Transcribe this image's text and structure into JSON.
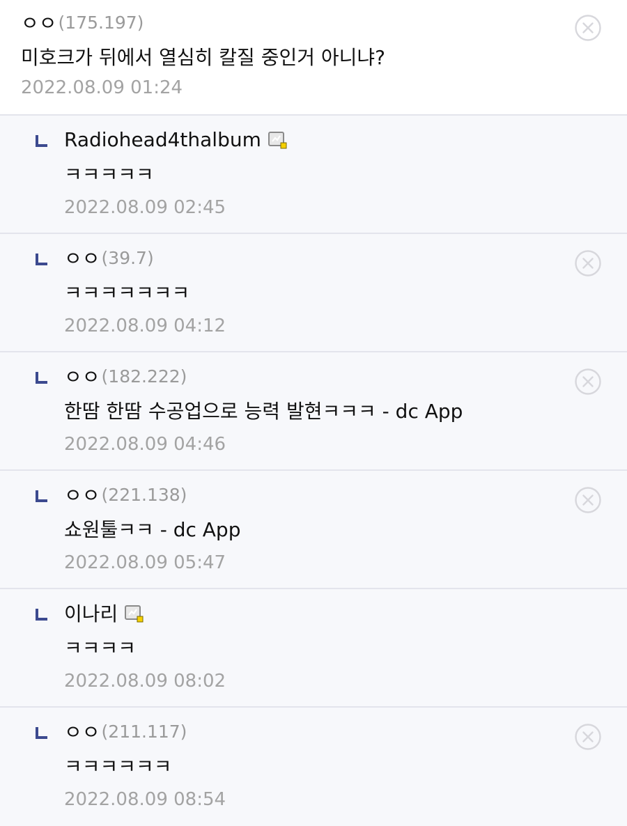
{
  "comments": [
    {
      "nick": "ㅇㅇ",
      "ip": "(175.197)",
      "text": "미호크가 뒤에서 열심히 칼질 중인거 아니냐?",
      "date": "2022.08.09 01:24",
      "deletable": true,
      "gallog_icon": false
    },
    {
      "nick": "Radiohead4thalbum",
      "ip": "",
      "text": "ㅋㅋㅋㅋㅋ",
      "date": "2022.08.09 02:45",
      "deletable": false,
      "gallog_icon": true
    },
    {
      "nick": "ㅇㅇ",
      "ip": "(39.7)",
      "text": "ㅋㅋㅋㅋㅋㅋㅋ",
      "date": "2022.08.09 04:12",
      "deletable": true,
      "gallog_icon": false
    },
    {
      "nick": "ㅇㅇ",
      "ip": "(182.222)",
      "text": "한땀 한땀 수공업으로 능력 발현ㅋㅋㅋ - dc App",
      "date": "2022.08.09 04:46",
      "deletable": true,
      "gallog_icon": false
    },
    {
      "nick": "ㅇㅇ",
      "ip": "(221.138)",
      "text": "쇼원툴ㅋㅋ - dc App",
      "date": "2022.08.09 05:47",
      "deletable": true,
      "gallog_icon": false
    },
    {
      "nick": "이나리",
      "ip": "",
      "text": "ㅋㅋㅋㅋ",
      "date": "2022.08.09 08:02",
      "deletable": false,
      "gallog_icon": true
    },
    {
      "nick": "ㅇㅇ",
      "ip": "(211.117)",
      "text": "ㅋㅋㅋㅋㅋㅋ",
      "date": "2022.08.09 08:54",
      "deletable": true,
      "gallog_icon": false
    }
  ],
  "icons": {
    "reply": "reply-arrow-icon",
    "delete": "delete-circle-x-icon",
    "gallog": "fixed-nick-gallog-icon"
  },
  "colors": {
    "reply_arrow": "#3c4a8f",
    "delete_icon": "#d7d7dc",
    "ip_text": "#9a9a9a",
    "date_text": "#a3a3a3",
    "reply_bg": "#f7f8fb",
    "divider": "#e3e4ec"
  }
}
